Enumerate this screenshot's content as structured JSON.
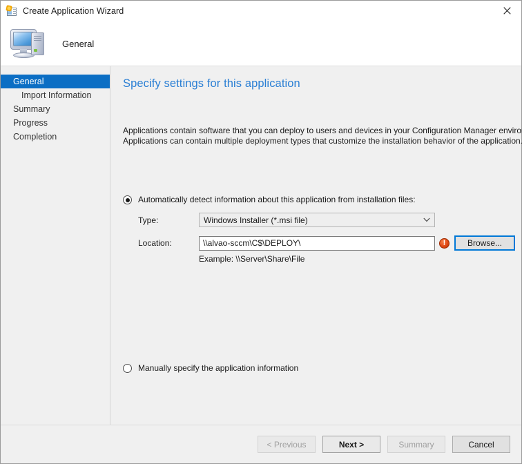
{
  "window": {
    "title": "Create Application Wizard",
    "title_icon": "wizard-application-icon",
    "close_icon": "close-icon"
  },
  "header": {
    "icon": "computer-icon",
    "page_name": "General"
  },
  "sidebar": {
    "items": [
      {
        "label": "General",
        "selected": true,
        "sub": false
      },
      {
        "label": "Import Information",
        "selected": false,
        "sub": true
      },
      {
        "label": "Summary",
        "selected": false,
        "sub": false
      },
      {
        "label": "Progress",
        "selected": false,
        "sub": false
      },
      {
        "label": "Completion",
        "selected": false,
        "sub": false
      }
    ]
  },
  "content": {
    "heading": "Specify settings for this application",
    "heading_color": "#2a7fd4",
    "intro_line_1": "Applications contain software that you can deploy to users and devices in your Configuration Manager environment.",
    "intro_line_2": "Applications can contain multiple deployment types that customize the installation behavior of the application.",
    "auto_option": {
      "label": "Automatically detect information about this application from installation files:",
      "selected": true,
      "type_field": {
        "label": "Type:",
        "value": "Windows Installer (*.msi file)",
        "dropdown_icon": "chevron-down-icon"
      },
      "location_field": {
        "label": "Location:",
        "value": "\\\\alvao-sccm\\C$\\DEPLOY\\",
        "error_icon": "error-exclamation-icon",
        "error_color": "#e04a16",
        "browse_label": "Browse...",
        "example": "Example: \\\\Server\\Share\\File"
      }
    },
    "manual_option": {
      "label": "Manually specify the application information",
      "selected": false
    }
  },
  "footer": {
    "buttons": [
      {
        "label": "< Previous",
        "disabled": true,
        "strong": false
      },
      {
        "label": "Next >",
        "disabled": false,
        "strong": true
      },
      {
        "label": "Summary",
        "disabled": true,
        "strong": false
      },
      {
        "label": "Cancel",
        "disabled": false,
        "strong": false
      }
    ]
  }
}
